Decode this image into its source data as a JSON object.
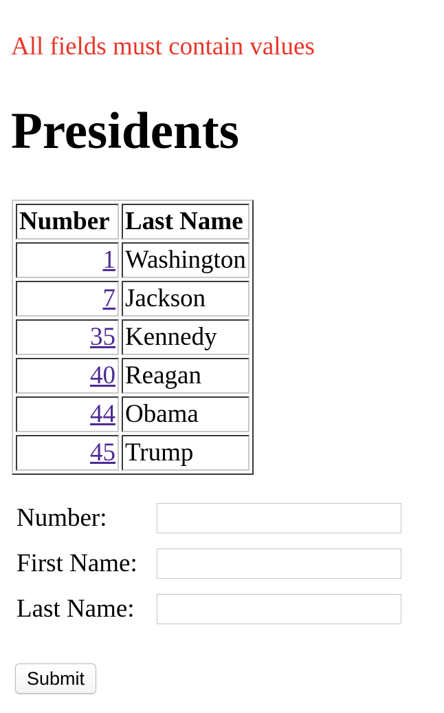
{
  "error_message": "All fields must contain values",
  "page_title": "Presidents",
  "table": {
    "headers": {
      "number": "Number",
      "last_name": "Last Name"
    },
    "rows": [
      {
        "number": "1",
        "last_name": "Washington"
      },
      {
        "number": "7",
        "last_name": "Jackson"
      },
      {
        "number": "35",
        "last_name": "Kennedy"
      },
      {
        "number": "40",
        "last_name": "Reagan"
      },
      {
        "number": "44",
        "last_name": "Obama"
      },
      {
        "number": "45",
        "last_name": "Trump"
      }
    ]
  },
  "form": {
    "number_label": "Number:",
    "number_value": "",
    "first_name_label": "First Name:",
    "first_name_value": "",
    "last_name_label": "Last Name:",
    "last_name_value": "",
    "submit_label": "Submit"
  },
  "colors": {
    "error": "#e8362a",
    "link_visited": "#4d2a94"
  }
}
